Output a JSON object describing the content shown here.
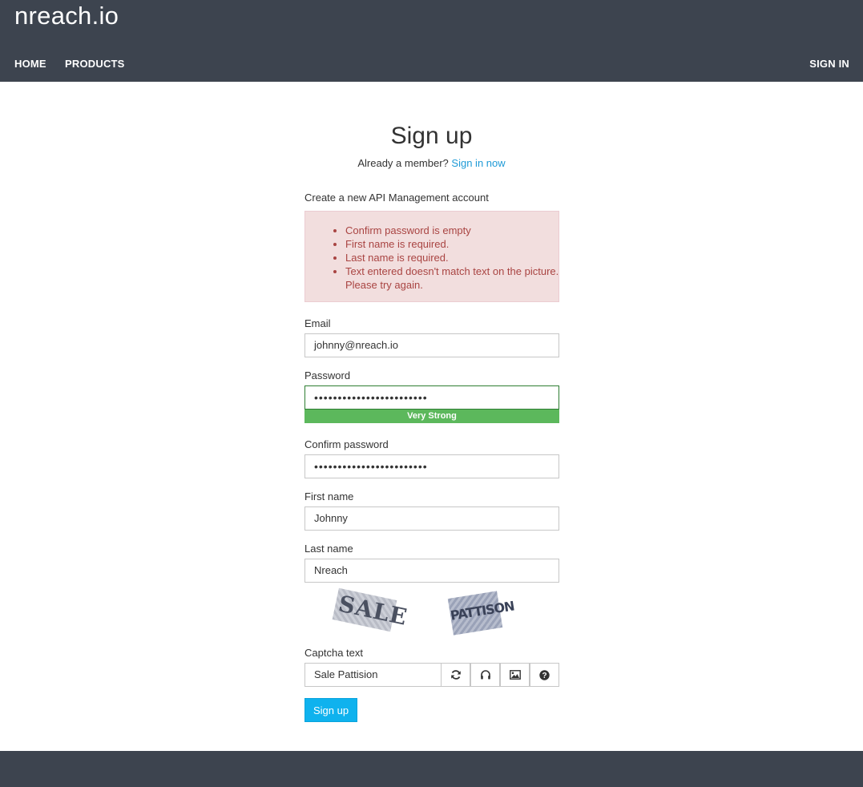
{
  "header": {
    "brand": "nreach.io",
    "nav": {
      "home": "HOME",
      "products": "PRODUCTS",
      "signin": "SIGN IN"
    }
  },
  "page": {
    "title": "Sign up",
    "member_text": "Already a member?",
    "member_link": "Sign in now",
    "create_text": "Create a new API Management account"
  },
  "errors": [
    "Confirm password is empty",
    "First name is required.",
    "Last name is required.",
    "Text entered doesn't match text on the picture. Please try again."
  ],
  "form": {
    "email": {
      "label": "Email",
      "value": "johnny@nreach.io"
    },
    "password": {
      "label": "Password",
      "value": "••••••••••••••••••••••••",
      "strength": "Very Strong"
    },
    "confirm": {
      "label": "Confirm password",
      "value": "••••••••••••••••••••••••"
    },
    "first": {
      "label": "First name",
      "value": "Johnny"
    },
    "last": {
      "label": "Last name",
      "value": "Nreach"
    },
    "captcha": {
      "word1": "SALE",
      "word2": "PATTISON",
      "label": "Captcha text",
      "value": "Sale Pattision",
      "buttons": [
        "refresh-icon",
        "headphones-icon",
        "image-icon",
        "question-icon"
      ]
    },
    "submit": "Sign up"
  },
  "colors": {
    "header": "#3d444f",
    "link": "#1e9ad6",
    "error_bg": "#f2dede",
    "error_text": "#a94442",
    "strength": "#5cb85c",
    "submit": "#0fb2ee"
  }
}
